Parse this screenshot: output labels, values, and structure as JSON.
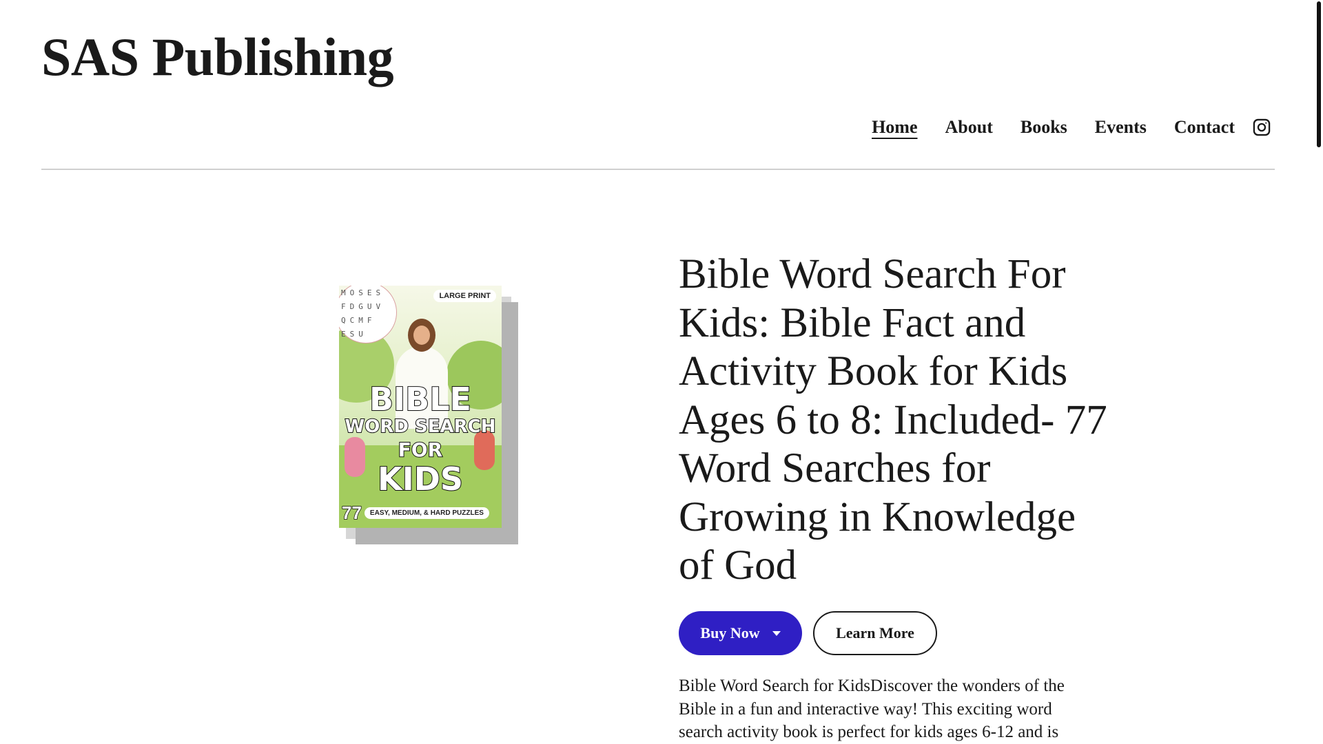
{
  "site": {
    "title": "SAS Publishing"
  },
  "nav": {
    "items": [
      {
        "label": "Home",
        "active": true
      },
      {
        "label": "About"
      },
      {
        "label": "Books"
      },
      {
        "label": "Events"
      },
      {
        "label": "Contact"
      }
    ],
    "social_icon": "instagram-icon"
  },
  "book": {
    "cover": {
      "badge": "LARGE PRINT",
      "grid_rows": [
        "MOSES",
        "FDGUV",
        "QCMF",
        "ESU"
      ],
      "title_lines": [
        "BIBLE",
        "WORD SEARCH",
        "FOR",
        "KIDS"
      ],
      "count": "77",
      "tagline": "EASY, MEDIUM, & HARD PUZZLES"
    },
    "title": "Bible Word Search For Kids: Bible Fact and Activity Book for Kids Ages 6 to 8: Included- 77 Word Searches for Growing in Knowledge of God",
    "buy_label": "Buy Now",
    "learn_label": "Learn More",
    "description": "Bible Word Search for KidsDiscover the wonders of the Bible in a fun and interactive way! This exciting word search activity book is perfect for kids ages 6-12 and is"
  },
  "colors": {
    "accent": "#2f1fc4",
    "text": "#1a1a1a",
    "divider": "#cfcfcf"
  }
}
